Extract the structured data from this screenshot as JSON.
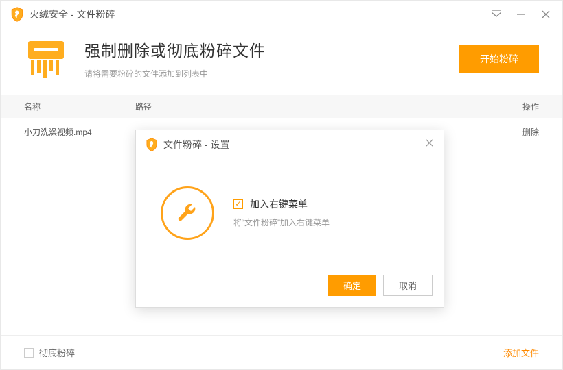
{
  "titlebar": {
    "title": "火绒安全 - 文件粉碎"
  },
  "header": {
    "title": "强制删除或彻底粉碎文件",
    "subtitle": "请将需要粉碎的文件添加到列表中",
    "start_label": "开始粉碎"
  },
  "table": {
    "headers": {
      "name": "名称",
      "path": "路径",
      "op": "操作"
    },
    "rows": [
      {
        "name": "小刀洗澡视频.mp4",
        "path": "",
        "op": "删除"
      }
    ]
  },
  "footer": {
    "thorough_label": "彻底粉碎",
    "add_file_label": "添加文件"
  },
  "modal": {
    "title": "文件粉碎 - 设置",
    "option_label": "加入右键菜单",
    "option_desc": "将“文件粉碎”加入右键菜单",
    "ok_label": "确定",
    "cancel_label": "取消"
  }
}
